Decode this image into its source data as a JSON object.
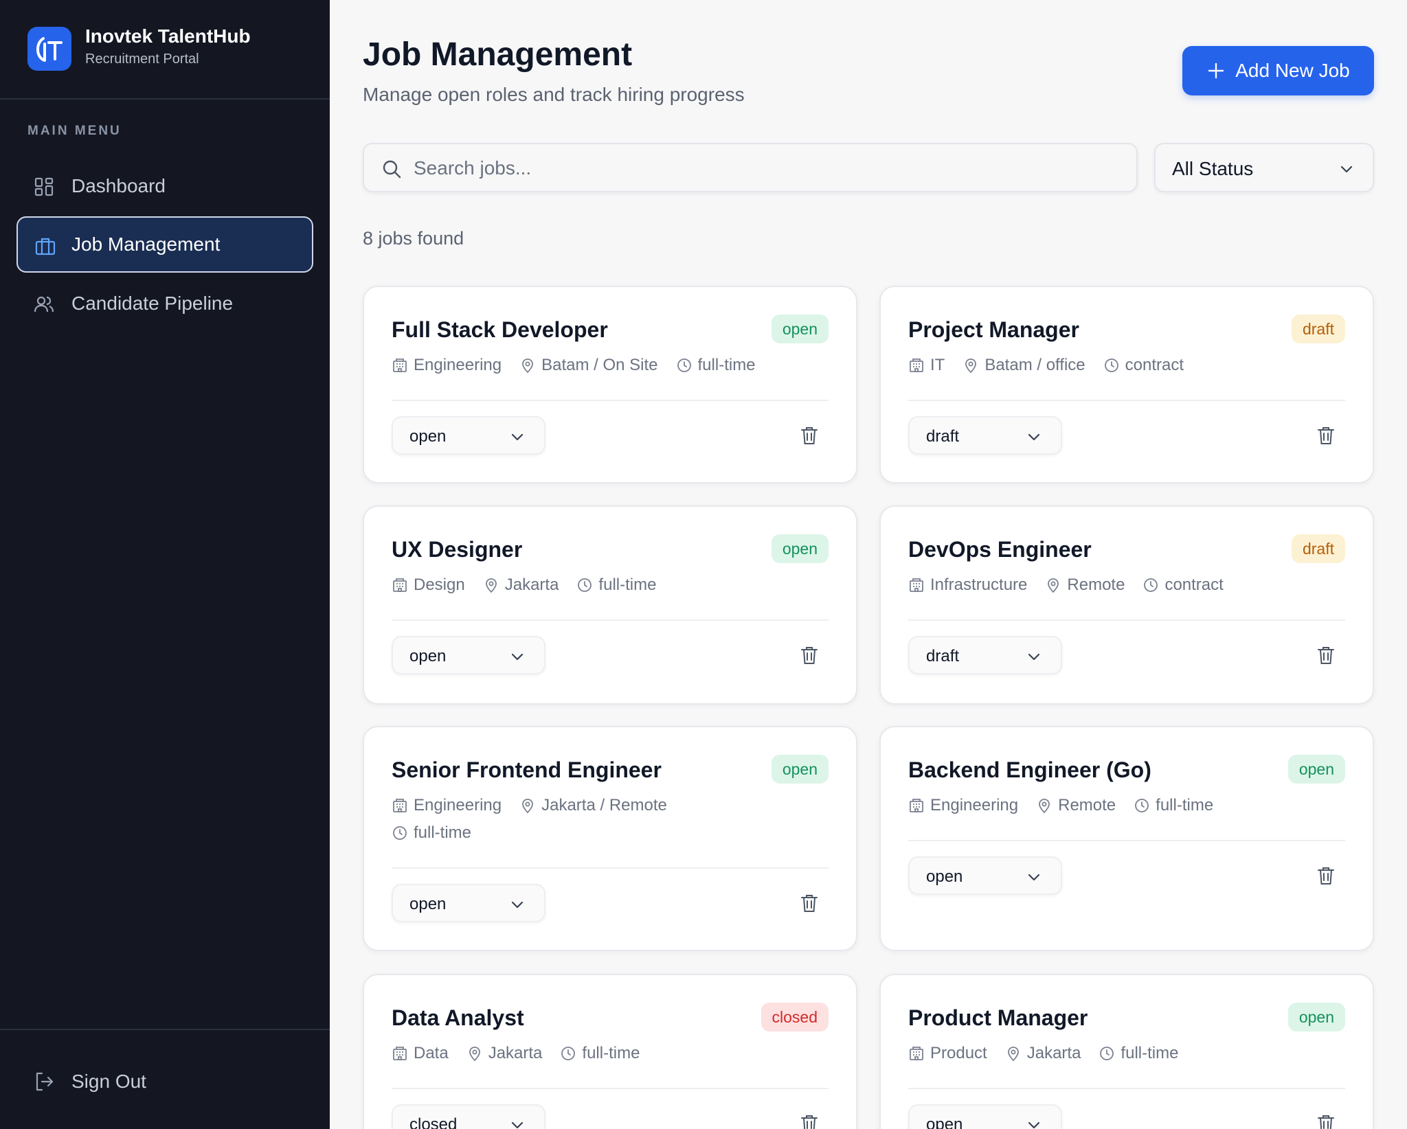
{
  "brand": {
    "title": "Inovtek TalentHub",
    "subtitle": "Recruitment Portal",
    "logo_text": "IT"
  },
  "sidebar": {
    "menu_label": "MAIN MENU",
    "items": [
      {
        "label": "Dashboard",
        "icon": "grid-icon",
        "active": false
      },
      {
        "label": "Job Management",
        "icon": "briefcase-icon",
        "active": true
      },
      {
        "label": "Candidate Pipeline",
        "icon": "users-icon",
        "active": false
      }
    ],
    "sign_out": "Sign Out"
  },
  "header": {
    "title": "Job Management",
    "subtitle": "Manage open roles and track hiring progress",
    "add_button": "Add New Job"
  },
  "filters": {
    "search_placeholder": "Search jobs...",
    "search_value": "",
    "status_selected": "All Status"
  },
  "results_text": "8 jobs found",
  "colors": {
    "accent": "#2563eb",
    "sidebar_bg": "#141722",
    "active_nav_bg": "#1a2d52"
  },
  "jobs": [
    {
      "title": "Full Stack Developer",
      "badge": "open",
      "department": "Engineering",
      "location": "Batam / On Site",
      "type": "full-time",
      "status": "open"
    },
    {
      "title": "Project Manager",
      "badge": "draft",
      "department": "IT",
      "location": "Batam / office",
      "type": "contract",
      "status": "draft"
    },
    {
      "title": "UX Designer",
      "badge": "open",
      "department": "Design",
      "location": "Jakarta",
      "type": "full-time",
      "status": "open"
    },
    {
      "title": "DevOps Engineer",
      "badge": "draft",
      "department": "Infrastructure",
      "location": "Remote",
      "type": "contract",
      "status": "draft"
    },
    {
      "title": "Senior Frontend Engineer",
      "badge": "open",
      "department": "Engineering",
      "location": "Jakarta / Remote",
      "type": "full-time",
      "status": "open"
    },
    {
      "title": "Backend Engineer (Go)",
      "badge": "open",
      "department": "Engineering",
      "location": "Remote",
      "type": "full-time",
      "status": "open"
    },
    {
      "title": "Data Analyst",
      "badge": "closed",
      "department": "Data",
      "location": "Jakarta",
      "type": "full-time",
      "status": "closed"
    },
    {
      "title": "Product Manager",
      "badge": "open",
      "department": "Product",
      "location": "Jakarta",
      "type": "full-time",
      "status": "open"
    }
  ]
}
